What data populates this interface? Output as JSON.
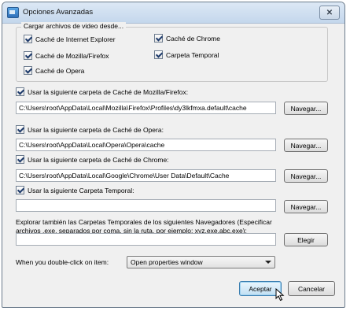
{
  "window": {
    "title": "Opciones Avanzadas",
    "close_glyph": "✕"
  },
  "group": {
    "title": "Cargar archivos de video desde...",
    "items": [
      {
        "label": "Caché de Internet Explorer",
        "checked": true
      },
      {
        "label": "Caché de Chrome",
        "checked": true
      },
      {
        "label": "Caché de Mozilla/Firefox",
        "checked": true
      },
      {
        "label": "Carpeta Temporal",
        "checked": true
      },
      {
        "label": "Caché de Opera",
        "checked": true
      }
    ]
  },
  "mozilla": {
    "label": "Usar la siguiente carpeta de Caché de Mozilla/Firefox:",
    "checked": true,
    "path": "C:\\Users\\root\\AppData\\Local\\Mozilla\\Firefox\\Profiles\\dy3lkfmxa.default\\cache",
    "browse": "Navegar..."
  },
  "opera": {
    "label": "Usar la siguiente carpeta de Caché de Opera:",
    "checked": true,
    "path": "C:\\Users\\root\\AppData\\Local\\Opera\\Opera\\cache",
    "browse": "Navegar..."
  },
  "chrome": {
    "label": "Usar la siguiente carpeta de Caché de Chrome:",
    "checked": true,
    "path": "C:\\Users\\root\\AppData\\Local\\Google\\Chrome\\User Data\\Default\\Cache",
    "browse": "Navegar..."
  },
  "temp": {
    "label": "Usar la siguiente Carpeta Temporal:",
    "checked": true,
    "path": "",
    "browse": "Navegar..."
  },
  "explore": {
    "text": "Explorar también las Carpetas Temporales de los siguientes Navegadores (Especificar archivos .exe, separados por coma, sin la ruta, por ejemplo: xyz.exe,abc.exe):",
    "value": "",
    "button": "Elegir"
  },
  "double_click": {
    "label": "When you double-click on item:",
    "selected": "Open properties window"
  },
  "footer": {
    "accept": "Aceptar",
    "cancel": "Cancelar"
  },
  "icons": {
    "app": "app-icon",
    "close": "close-icon",
    "cursor": "mouse-cursor-icon",
    "dropdown": "chevron-down-icon"
  }
}
